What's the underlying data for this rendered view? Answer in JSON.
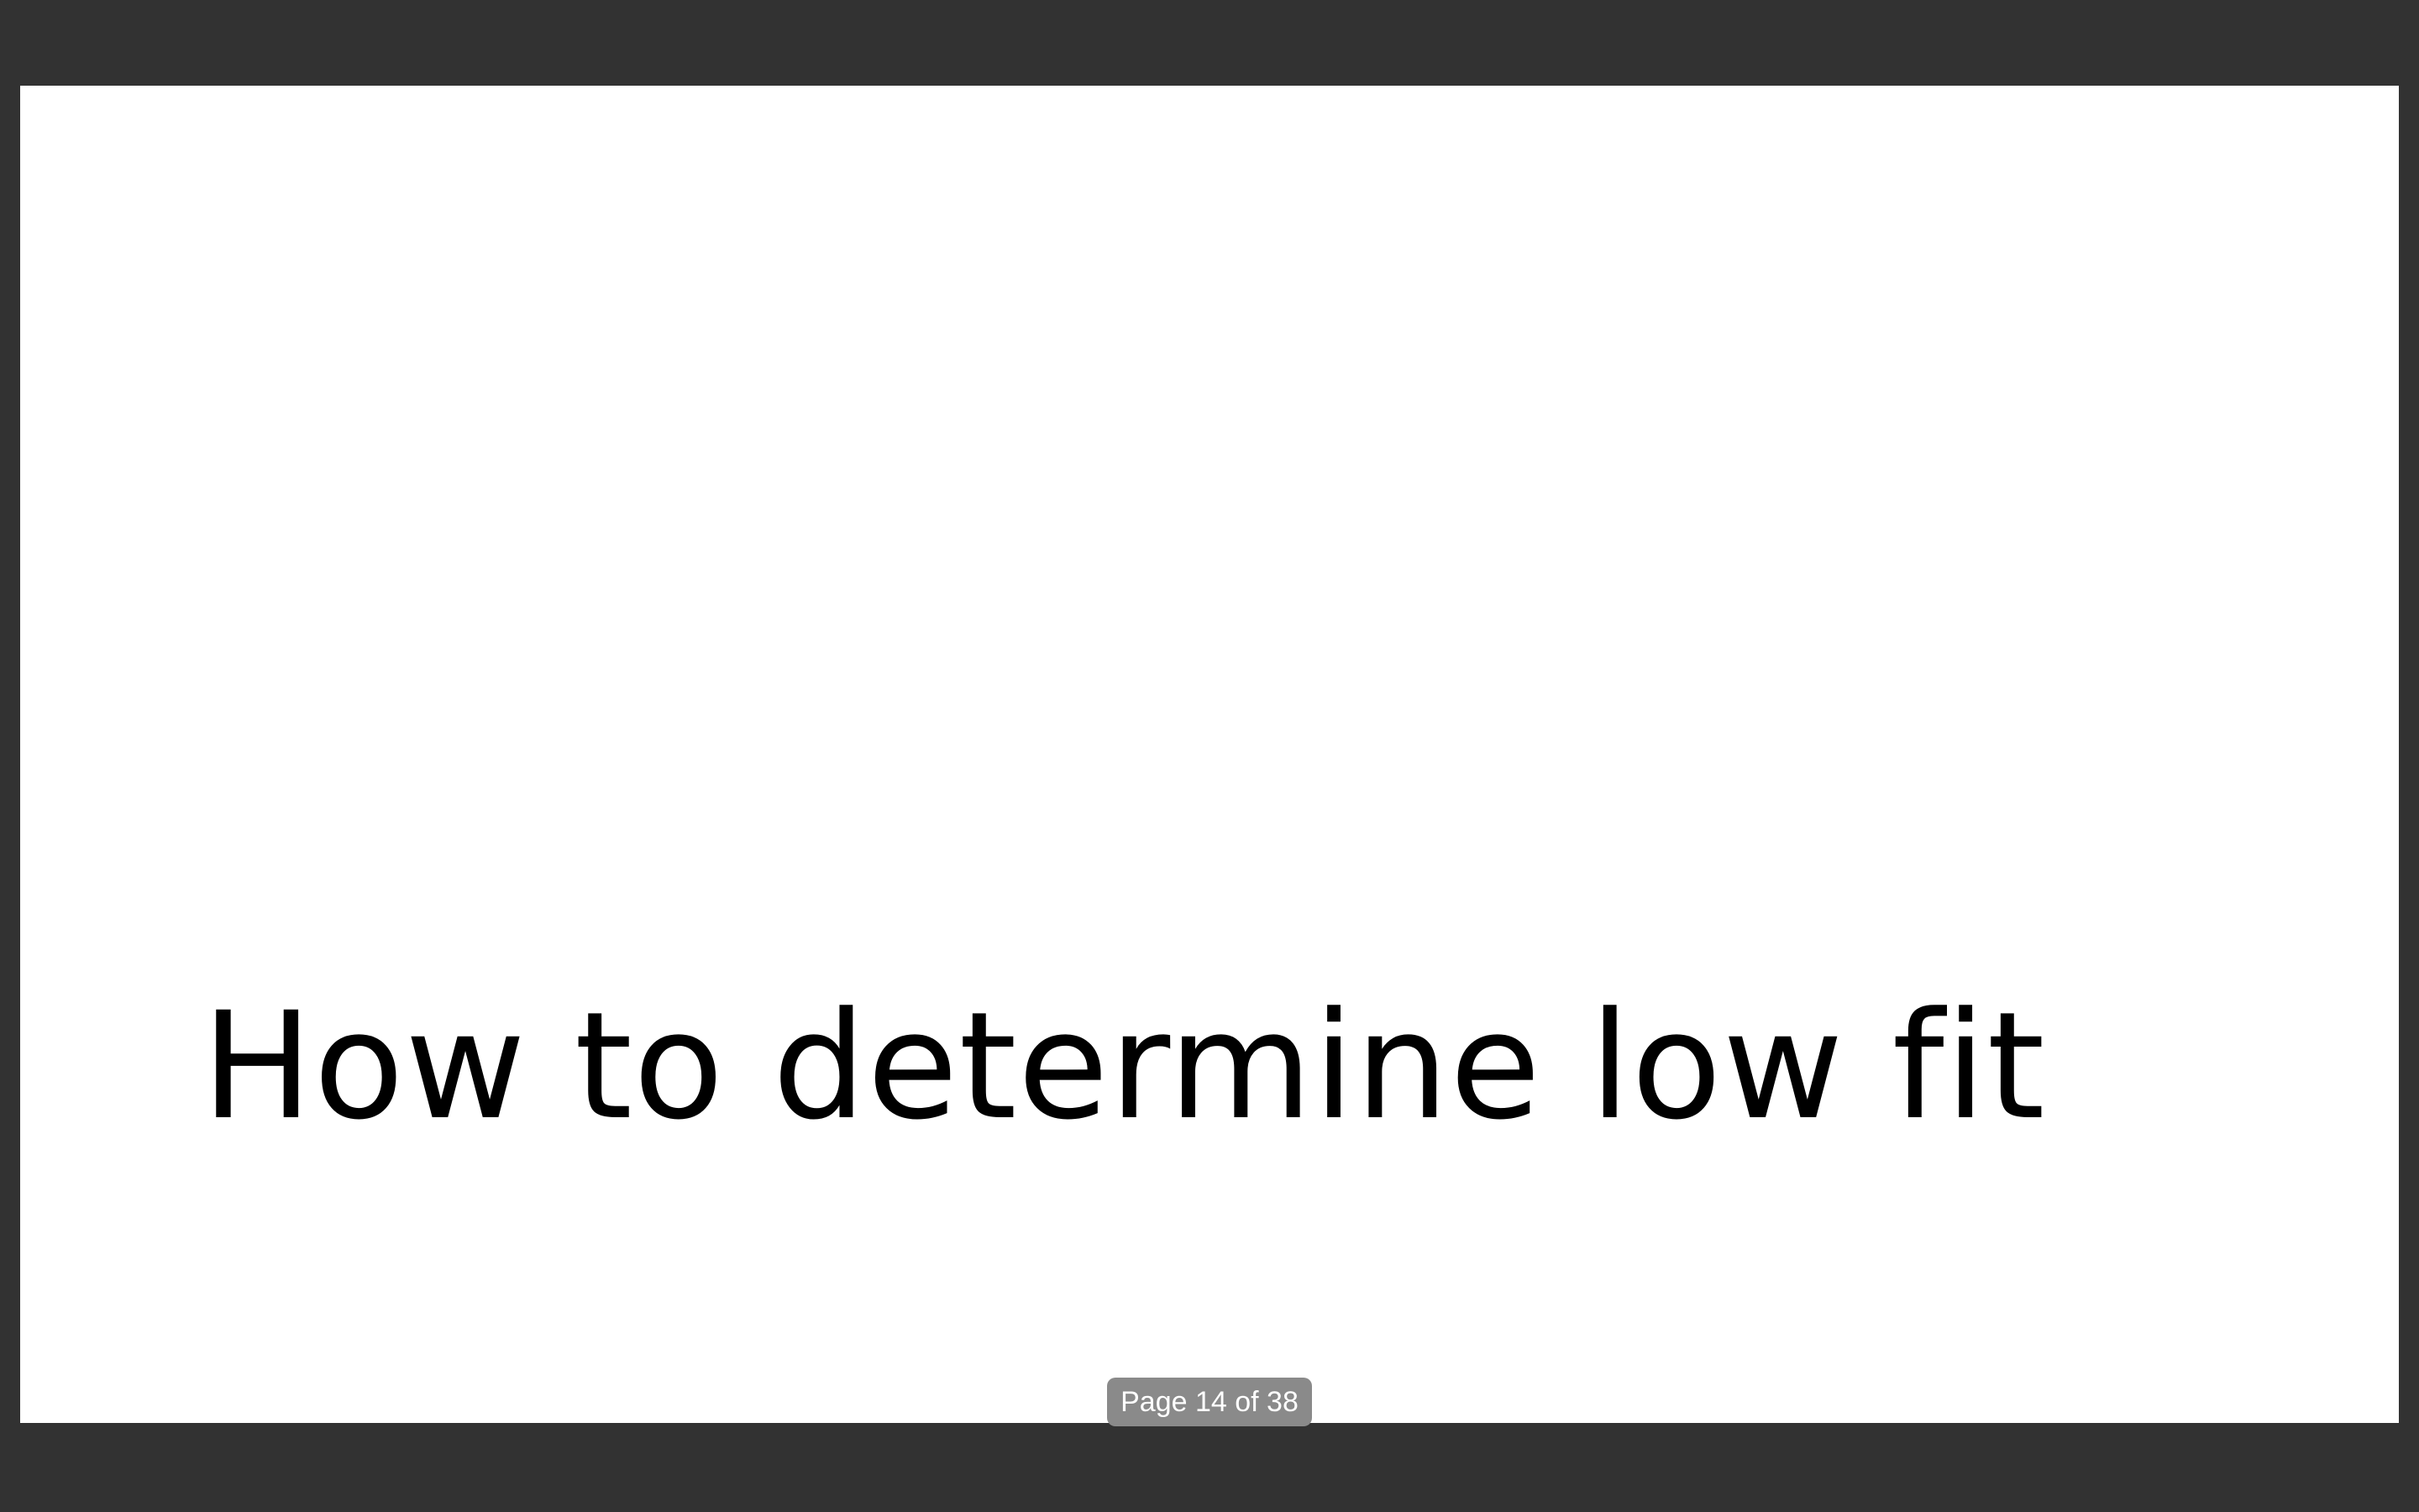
{
  "slide": {
    "title": "How to determine low fit"
  },
  "page_indicator": {
    "label": "Page 14 of 38",
    "current": 14,
    "total": 38
  },
  "colors": {
    "viewer_background": "#323232",
    "page_background": "#ffffff",
    "indicator_background": "#8a8a8a",
    "text": "#000000"
  }
}
